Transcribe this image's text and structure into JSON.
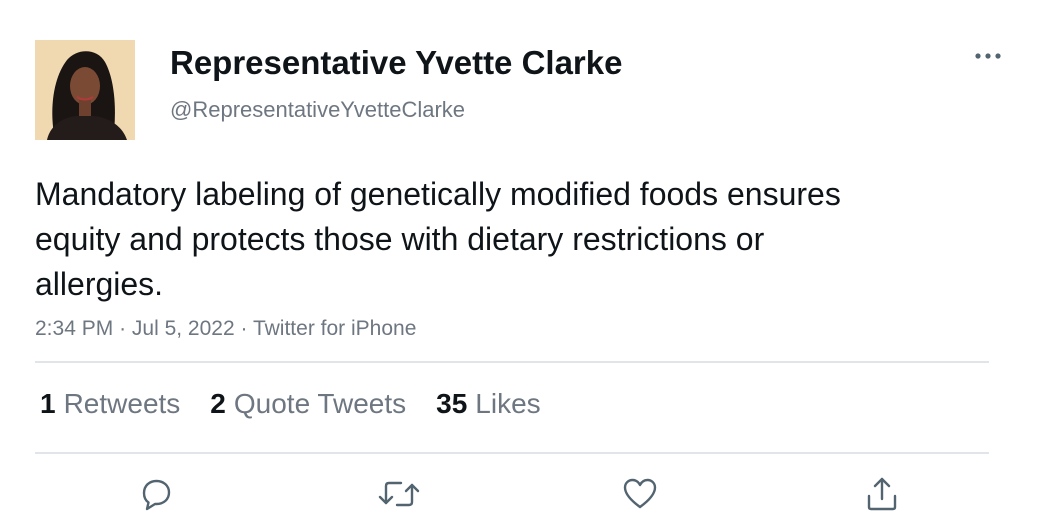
{
  "author": {
    "display_name": "Representative Yvette Clarke",
    "handle": "@RepresentativeYvetteClarke",
    "avatar_icon": "person-photo-icon"
  },
  "tweet": {
    "text": "Mandatory labeling of genetically modified foods ensures equity and protects those with dietary restrictions or allergies.",
    "time": "2:34 PM",
    "separator": "·",
    "date": "Jul 5, 2022",
    "source": "Twitter for iPhone"
  },
  "stats": {
    "retweets": {
      "count": "1",
      "label": "Retweets"
    },
    "quote_tweets": {
      "count": "2",
      "label": "Quote Tweets"
    },
    "likes": {
      "count": "35",
      "label": "Likes"
    }
  },
  "actions": [
    {
      "name": "reply",
      "icon": "reply-icon"
    },
    {
      "name": "retweet",
      "icon": "retweet-icon"
    },
    {
      "name": "like",
      "icon": "heart-icon"
    },
    {
      "name": "share",
      "icon": "share-icon"
    }
  ],
  "colors": {
    "text": "#0f1419",
    "secondary": "#6e7781",
    "divider": "#e1e4e8",
    "icon": "#536471"
  }
}
